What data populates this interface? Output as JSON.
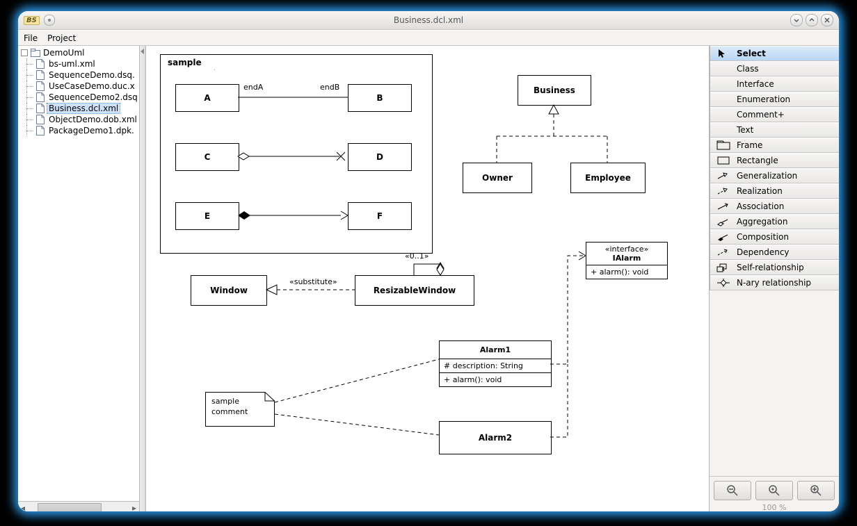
{
  "app": {
    "badge": "BS",
    "title": "Business.dcl.xml"
  },
  "menubar": {
    "file": "File",
    "project": "Project"
  },
  "tree": {
    "root": "DemoUml",
    "items": [
      {
        "label": "bs-uml.xml"
      },
      {
        "label": "SequenceDemo.dsq."
      },
      {
        "label": "UseCaseDemo.duc.x"
      },
      {
        "label": "SequenceDemo2.dsq"
      },
      {
        "label": "Business.dcl.xml",
        "selected": true
      },
      {
        "label": "ObjectDemo.dob.xml"
      },
      {
        "label": "PackageDemo1.dpk."
      }
    ]
  },
  "diagram": {
    "frame_label": "sample",
    "endA": "endA",
    "endB": "endB",
    "A": "A",
    "B": "B",
    "C": "C",
    "D": "D",
    "E": "E",
    "F": "F",
    "Business": "Business",
    "Owner": "Owner",
    "Employee": "Employee",
    "Window": "Window",
    "substitute": "«substitute»",
    "ResizableWindow": "ResizableWindow",
    "mult": "«0..1»",
    "IAlarm_stereo": "«interface»",
    "IAlarm_name": "IAlarm",
    "IAlarm_op": "+ alarm(): void",
    "Alarm1": "Alarm1",
    "Alarm1_attr": "# description: String",
    "Alarm1_op": "+ alarm(): void",
    "Alarm2": "Alarm2",
    "comment_l1": "sample",
    "comment_l2": "comment"
  },
  "tools": [
    {
      "key": "select",
      "label": "Select",
      "icon": "cursor",
      "selected": true
    },
    {
      "key": "class",
      "label": "Class",
      "icon": "none"
    },
    {
      "key": "interface",
      "label": "Interface",
      "icon": "none"
    },
    {
      "key": "enum",
      "label": "Enumeration",
      "icon": "none"
    },
    {
      "key": "comment",
      "label": "Comment+",
      "icon": "none"
    },
    {
      "key": "text",
      "label": "Text",
      "icon": "none"
    },
    {
      "key": "frame",
      "label": "Frame",
      "icon": "frame"
    },
    {
      "key": "rect",
      "label": "Rectangle",
      "icon": "rect"
    },
    {
      "key": "gen",
      "label": "Generalization",
      "icon": "arrow-open"
    },
    {
      "key": "real",
      "label": "Realization",
      "icon": "arrow-dashed"
    },
    {
      "key": "assoc",
      "label": "Association",
      "icon": "arrow-plain"
    },
    {
      "key": "aggr",
      "label": "Aggregation",
      "icon": "diamond-open"
    },
    {
      "key": "comp",
      "label": "Composition",
      "icon": "diamond-filled"
    },
    {
      "key": "dep",
      "label": "Dependency",
      "icon": "dep"
    },
    {
      "key": "self",
      "label": "Self-relationship",
      "icon": "self"
    },
    {
      "key": "nary",
      "label": "N-ary relationship",
      "icon": "nary"
    }
  ],
  "zoom": {
    "label": "100 %"
  }
}
